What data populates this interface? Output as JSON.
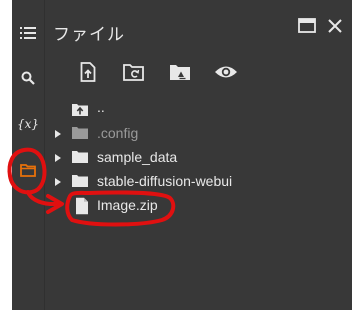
{
  "panel": {
    "title": "ファイル"
  },
  "rail": {
    "items": [
      {
        "icon": "menu-icon"
      },
      {
        "icon": "search-icon"
      },
      {
        "icon": "variables-icon",
        "label": "{x}"
      },
      {
        "icon": "folder-icon"
      }
    ]
  },
  "toolbar": {
    "buttons": [
      {
        "icon": "upload-file-icon"
      },
      {
        "icon": "refresh-folder-icon"
      },
      {
        "icon": "mount-drive-icon"
      },
      {
        "icon": "show-hidden-icon"
      }
    ]
  },
  "tree": {
    "parent_label": "..",
    "items": [
      {
        "label": ".config",
        "type": "folder",
        "hidden": true
      },
      {
        "label": "sample_data",
        "type": "folder"
      },
      {
        "label": "stable-diffusion-webui",
        "type": "folder"
      },
      {
        "label": "Image.zip",
        "type": "file"
      }
    ]
  },
  "colors": {
    "background": "#383838",
    "text": "#e8e8e8",
    "muted_text": "#9a9a9a",
    "accent_orange": "#e8710a",
    "annotation_red": "#e01010"
  }
}
